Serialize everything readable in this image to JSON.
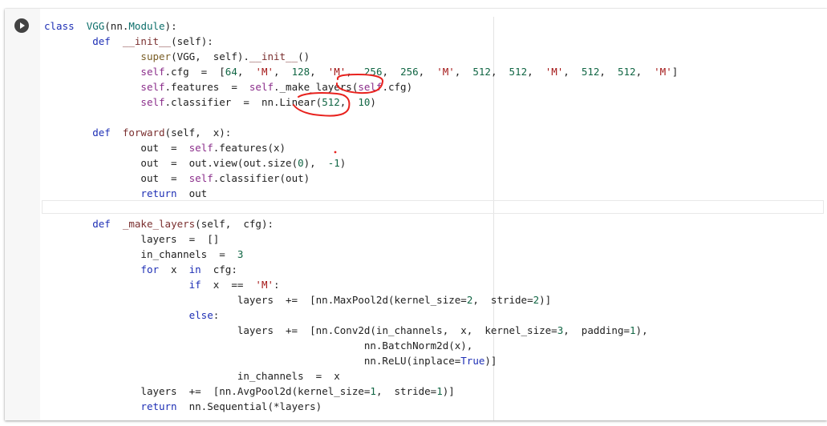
{
  "cell": {
    "run_button_label": "",
    "lines": [
      {
        "indent": 0,
        "tokens": [
          [
            "kw",
            "class"
          ],
          [
            "t",
            "  "
          ],
          [
            "cls",
            "VGG"
          ],
          [
            "t",
            "(nn."
          ],
          [
            "cls",
            "Module"
          ],
          [
            "t",
            "):"
          ]
        ]
      },
      {
        "indent": 1,
        "tokens": [
          [
            "kw",
            "def"
          ],
          [
            "t",
            "  "
          ],
          [
            "fn",
            "__init__"
          ],
          [
            "t",
            "(self):"
          ]
        ]
      },
      {
        "indent": 2,
        "tokens": [
          [
            "bi",
            "super"
          ],
          [
            "t",
            "(VGG,  self)."
          ],
          [
            "fn",
            "__init__"
          ],
          [
            "t",
            "()"
          ]
        ]
      },
      {
        "indent": 2,
        "tokens": [
          [
            "self",
            "self"
          ],
          [
            "t",
            ".cfg  =  ["
          ],
          [
            "num",
            "64"
          ],
          [
            "t",
            ",  "
          ],
          [
            "str",
            "'M'"
          ],
          [
            "t",
            ",  "
          ],
          [
            "num",
            "128"
          ],
          [
            "t",
            ",  "
          ],
          [
            "str",
            "'M'"
          ],
          [
            "t",
            ",  "
          ],
          [
            "num",
            "256"
          ],
          [
            "t",
            ",  "
          ],
          [
            "num",
            "256"
          ],
          [
            "t",
            ",  "
          ],
          [
            "str",
            "'M'"
          ],
          [
            "t",
            ",  "
          ],
          [
            "num",
            "512"
          ],
          [
            "t",
            ",  "
          ],
          [
            "num",
            "512"
          ],
          [
            "t",
            ",  "
          ],
          [
            "str",
            "'M'"
          ],
          [
            "t",
            ",  "
          ],
          [
            "num",
            "512"
          ],
          [
            "t",
            ",  "
          ],
          [
            "num",
            "512"
          ],
          [
            "t",
            ",  "
          ],
          [
            "str",
            "'M'"
          ],
          [
            "t",
            "]"
          ]
        ]
      },
      {
        "indent": 2,
        "tokens": [
          [
            "self",
            "self"
          ],
          [
            "t",
            ".features  =  "
          ],
          [
            "self",
            "self"
          ],
          [
            "t",
            "._make_layers("
          ],
          [
            "self",
            "self"
          ],
          [
            "t",
            ".cfg)"
          ]
        ]
      },
      {
        "indent": 2,
        "tokens": [
          [
            "self",
            "self"
          ],
          [
            "t",
            ".classifier  =  nn.Linear("
          ],
          [
            "num",
            "512"
          ],
          [
            "t",
            ",  "
          ],
          [
            "num",
            "10"
          ],
          [
            "t",
            ")"
          ]
        ]
      },
      {
        "indent": 0,
        "tokens": []
      },
      {
        "indent": 1,
        "tokens": [
          [
            "kw",
            "def"
          ],
          [
            "t",
            "  "
          ],
          [
            "fn",
            "forward"
          ],
          [
            "t",
            "(self,  x):"
          ]
        ]
      },
      {
        "indent": 2,
        "tokens": [
          [
            "t",
            "out  =  "
          ],
          [
            "self",
            "self"
          ],
          [
            "t",
            ".features(x)"
          ]
        ]
      },
      {
        "indent": 2,
        "tokens": [
          [
            "t",
            "out  =  out.view(out.size("
          ],
          [
            "num",
            "0"
          ],
          [
            "t",
            "),  "
          ],
          [
            "num",
            "-1"
          ],
          [
            "t",
            ")"
          ]
        ]
      },
      {
        "indent": 2,
        "tokens": [
          [
            "t",
            "out  =  "
          ],
          [
            "self",
            "self"
          ],
          [
            "t",
            ".classifier(out)"
          ]
        ]
      },
      {
        "indent": 2,
        "tokens": [
          [
            "kw",
            "return"
          ],
          [
            "t",
            "  out"
          ]
        ]
      },
      {
        "indent": 0,
        "tokens": []
      },
      {
        "indent": 1,
        "tokens": [
          [
            "kw",
            "def"
          ],
          [
            "t",
            "  "
          ],
          [
            "fn",
            "_make_layers"
          ],
          [
            "t",
            "(self,  cfg):"
          ]
        ]
      },
      {
        "indent": 2,
        "tokens": [
          [
            "t",
            "layers  =  []"
          ]
        ]
      },
      {
        "indent": 2,
        "tokens": [
          [
            "t",
            "in_channels  =  "
          ],
          [
            "num",
            "3"
          ]
        ]
      },
      {
        "indent": 2,
        "tokens": [
          [
            "kw",
            "for"
          ],
          [
            "t",
            "  x  "
          ],
          [
            "kw",
            "in"
          ],
          [
            "t",
            "  cfg:"
          ]
        ]
      },
      {
        "indent": 3,
        "tokens": [
          [
            "kw",
            "if"
          ],
          [
            "t",
            "  x  ==  "
          ],
          [
            "str",
            "'M'"
          ],
          [
            "t",
            ":"
          ]
        ]
      },
      {
        "indent": 4,
        "tokens": [
          [
            "t",
            "layers  +=  [nn.MaxPool2d(kernel_size="
          ],
          [
            "num",
            "2"
          ],
          [
            "t",
            ",  stride="
          ],
          [
            "num",
            "2"
          ],
          [
            "t",
            ")]"
          ]
        ]
      },
      {
        "indent": 3,
        "tokens": [
          [
            "kw",
            "else"
          ],
          [
            "t",
            ":"
          ]
        ]
      },
      {
        "indent": 4,
        "tokens": [
          [
            "t",
            "layers  +=  [nn.Conv2d(in_channels,  x,  kernel_size="
          ],
          [
            "num",
            "3"
          ],
          [
            "t",
            ",  padding="
          ],
          [
            "num",
            "1"
          ],
          [
            "t",
            "),"
          ]
        ]
      },
      {
        "indent": 4,
        "pad": "                     ",
        "tokens": [
          [
            "t",
            "nn.BatchNorm2d(x),"
          ]
        ]
      },
      {
        "indent": 4,
        "pad": "                     ",
        "tokens": [
          [
            "t",
            "nn.ReLU(inplace="
          ],
          [
            "kw",
            "True"
          ],
          [
            "t",
            ")]"
          ]
        ]
      },
      {
        "indent": 4,
        "tokens": [
          [
            "t",
            "in_channels  =  x"
          ]
        ]
      },
      {
        "indent": 2,
        "tokens": [
          [
            "t",
            "layers  +=  [nn.AvgPool2d(kernel_size="
          ],
          [
            "num",
            "1"
          ],
          [
            "t",
            ",  stride="
          ],
          [
            "num",
            "1"
          ],
          [
            "t",
            ")]"
          ]
        ]
      },
      {
        "indent": 2,
        "tokens": [
          [
            "kw",
            "return"
          ],
          [
            "t",
            "  nn.Sequential(*layers)"
          ]
        ]
      }
    ]
  },
  "colors": {
    "keyword": "#1e2fb5",
    "number": "#116644",
    "string": "#a31515",
    "self": "#8b2e8b",
    "annotation": "#e8221e"
  },
  "icons": {
    "run": "play-circle-icon"
  }
}
